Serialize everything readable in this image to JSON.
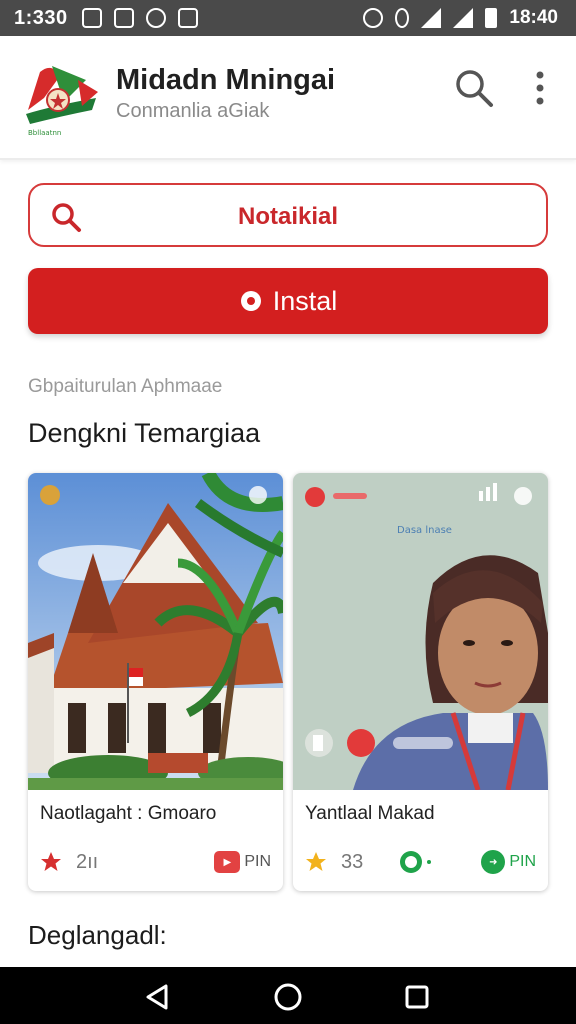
{
  "status_bar": {
    "time": "1:330",
    "right_time": "18:40"
  },
  "header": {
    "title": "Midadn Mningai",
    "subtitle": "Conmanlia aGiak",
    "logo_caption": "Bbllaatnn"
  },
  "search": {
    "value": "Notaikial"
  },
  "install_button": {
    "label": "Instal"
  },
  "section": {
    "caption": "Gbpaiturulan Aphmaae",
    "title": "Dengkni Temargiaa"
  },
  "cards": [
    {
      "title": "Naotlagaht : Gmoaro",
      "stat_value": "2ıı",
      "badge_label": "PIN"
    },
    {
      "title": "Yantlaal Makad",
      "stat_value": "33",
      "badge_label": "PIN",
      "overlay_caption": "Dasa lnase"
    }
  ],
  "footer_heading": "Deglangadl:",
  "colors": {
    "accent_red": "#d31f1f",
    "search_border": "#d63b3b",
    "badge_green": "#1fa34a",
    "status_bar": "#4a4a4a"
  },
  "icons": {
    "header_search": "search-icon",
    "header_menu": "more-vertical-icon",
    "search_field": "search-icon",
    "install": "record-icon",
    "card1_stat": "star-icon",
    "card2_stat": "star-icon"
  }
}
